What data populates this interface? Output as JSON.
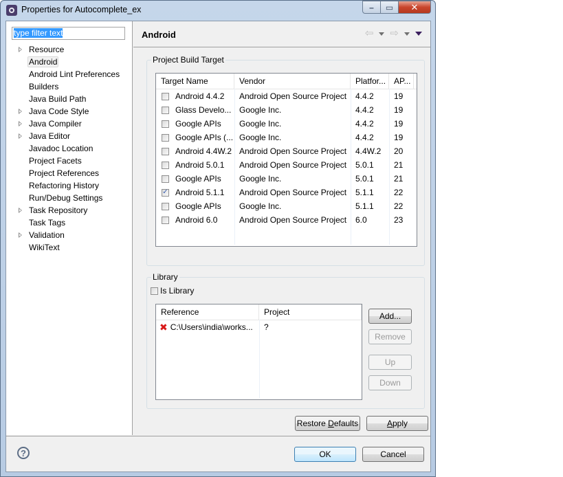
{
  "window": {
    "title": "Properties for Autocomplete_ex",
    "icon": "eclipse-gear-icon",
    "controls": {
      "minimize": "–",
      "maximize": "▭",
      "close": "✕"
    }
  },
  "filter": {
    "value": "type filter text"
  },
  "sidebar": {
    "items": [
      {
        "label": "Resource",
        "expandable": true,
        "selected": false
      },
      {
        "label": "Android",
        "expandable": false,
        "selected": true
      },
      {
        "label": "Android Lint Preferences",
        "expandable": false,
        "selected": false
      },
      {
        "label": "Builders",
        "expandable": false,
        "selected": false
      },
      {
        "label": "Java Build Path",
        "expandable": false,
        "selected": false
      },
      {
        "label": "Java Code Style",
        "expandable": true,
        "selected": false
      },
      {
        "label": "Java Compiler",
        "expandable": true,
        "selected": false
      },
      {
        "label": "Java Editor",
        "expandable": true,
        "selected": false
      },
      {
        "label": "Javadoc Location",
        "expandable": false,
        "selected": false
      },
      {
        "label": "Project Facets",
        "expandable": false,
        "selected": false
      },
      {
        "label": "Project References",
        "expandable": false,
        "selected": false
      },
      {
        "label": "Refactoring History",
        "expandable": false,
        "selected": false
      },
      {
        "label": "Run/Debug Settings",
        "expandable": false,
        "selected": false
      },
      {
        "label": "Task Repository",
        "expandable": true,
        "selected": false
      },
      {
        "label": "Task Tags",
        "expandable": false,
        "selected": false
      },
      {
        "label": "Validation",
        "expandable": true,
        "selected": false
      },
      {
        "label": "WikiText",
        "expandable": false,
        "selected": false
      }
    ]
  },
  "page": {
    "title": "Android",
    "nav": {
      "back": "⇦",
      "forward": "⇨"
    }
  },
  "build_target": {
    "legend": "Project Build Target",
    "columns": [
      "Target Name",
      "Vendor",
      "Platfor...",
      "AP..."
    ],
    "rows": [
      {
        "name": "Android 4.4.2",
        "vendor": "Android Open Source Project",
        "platform": "4.4.2",
        "api": "19",
        "checked": false
      },
      {
        "name": "Glass Develo...",
        "vendor": "Google Inc.",
        "platform": "4.4.2",
        "api": "19",
        "checked": false
      },
      {
        "name": "Google APIs",
        "vendor": "Google Inc.",
        "platform": "4.4.2",
        "api": "19",
        "checked": false
      },
      {
        "name": "Google APIs (...",
        "vendor": "Google Inc.",
        "platform": "4.4.2",
        "api": "19",
        "checked": false
      },
      {
        "name": "Android 4.4W.2",
        "vendor": "Android Open Source Project",
        "platform": "4.4W.2",
        "api": "20",
        "checked": false
      },
      {
        "name": "Android 5.0.1",
        "vendor": "Android Open Source Project",
        "platform": "5.0.1",
        "api": "21",
        "checked": false
      },
      {
        "name": "Google APIs",
        "vendor": "Google Inc.",
        "platform": "5.0.1",
        "api": "21",
        "checked": false
      },
      {
        "name": "Android 5.1.1",
        "vendor": "Android Open Source Project",
        "platform": "5.1.1",
        "api": "22",
        "checked": true
      },
      {
        "name": "Google APIs",
        "vendor": "Google Inc.",
        "platform": "5.1.1",
        "api": "22",
        "checked": false
      },
      {
        "name": "Android 6.0",
        "vendor": "Android Open Source Project",
        "platform": "6.0",
        "api": "23",
        "checked": false
      }
    ]
  },
  "library": {
    "legend": "Library",
    "is_library_label": "Is Library",
    "is_library_checked": false,
    "columns": [
      "Reference",
      "Project"
    ],
    "rows": [
      {
        "reference": "C:\\Users\\india\\works...",
        "project": "?",
        "status_icon": "error-x-icon"
      }
    ],
    "buttons": {
      "add": "Add...",
      "remove": "Remove",
      "up": "Up",
      "down": "Down"
    }
  },
  "page_buttons": {
    "restore_defaults": "Restore Defaults",
    "restore_mnemonic": "D",
    "apply": "Apply",
    "apply_mnemonic": "A"
  },
  "dialog_buttons": {
    "ok": "OK",
    "cancel": "Cancel",
    "help": "?"
  }
}
